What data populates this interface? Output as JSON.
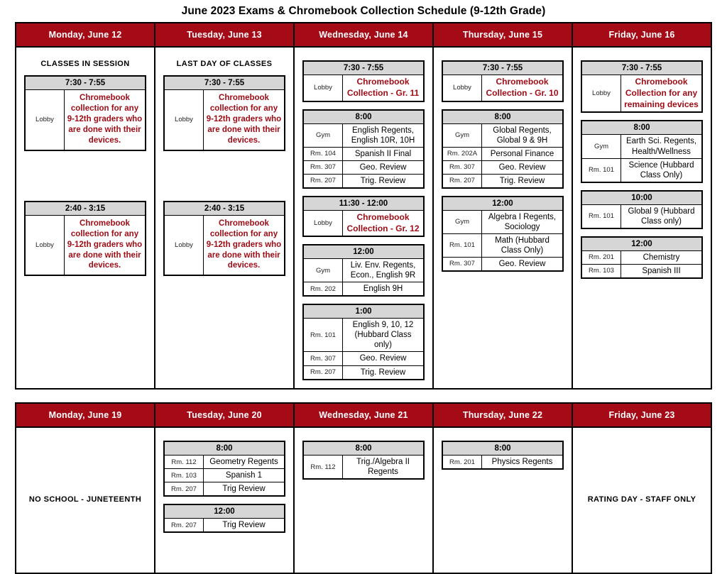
{
  "document": {
    "title": "June 2023 Exams & Chromebook Collection Schedule (9-12th Grade)",
    "accent_red": "#A50B16",
    "text_red": "#9E0B14",
    "timebar_gray": "#d6d6d6"
  },
  "weeks": [
    {
      "name": "week-1",
      "days": [
        {
          "header": "Monday, June 12",
          "note": "CLASSES IN SESSION",
          "note_center": false,
          "blocks": [
            {
              "time": "7:30 - 7:55",
              "rows": [
                {
                  "room": "Lobby",
                  "subject": "Chromebook collection for any 9-12th graders who are done with their devices.",
                  "style": "redpara"
                }
              ]
            },
            {
              "time": "2:40 - 3:15",
              "gap": "large",
              "rows": [
                {
                  "room": "Lobby",
                  "subject": "Chromebook collection for any 9-12th graders who are done with their devices.",
                  "style": "redpara"
                }
              ]
            }
          ]
        },
        {
          "header": "Tuesday, June 13",
          "note": "LAST DAY OF CLASSES",
          "note_center": false,
          "blocks": [
            {
              "time": "7:30 - 7:55",
              "rows": [
                {
                  "room": "Lobby",
                  "subject": "Chromebook collection for any 9-12th graders who are done with their devices.",
                  "style": "redpara"
                }
              ]
            },
            {
              "time": "2:40 - 3:15",
              "gap": "large",
              "rows": [
                {
                  "room": "Lobby",
                  "subject": "Chromebook collection for any 9-12th graders who are done with their devices.",
                  "style": "redpara"
                }
              ]
            }
          ]
        },
        {
          "header": "Wednesday, June 14",
          "note": "",
          "blocks": [
            {
              "time": "7:30 - 7:55",
              "rows": [
                {
                  "room": "Lobby",
                  "subject": "Chromebook Collection - Gr. 11",
                  "style": "red"
                }
              ]
            },
            {
              "time": "8:00",
              "rows": [
                {
                  "room": "Gym",
                  "subject": "English Regents, English 10R, 10H"
                },
                {
                  "room": "Rm. 104",
                  "subject": "Spanish II Final"
                },
                {
                  "room": "Rm. 307",
                  "subject": "Geo. Review"
                },
                {
                  "room": "Rm. 207",
                  "subject": "Trig. Review"
                }
              ]
            },
            {
              "time": "11:30 - 12:00",
              "rows": [
                {
                  "room": "Lobby",
                  "subject": "Chromebook Collection - Gr. 12",
                  "style": "red"
                }
              ]
            },
            {
              "time": "12:00",
              "rows": [
                {
                  "room": "Gym",
                  "subject": "Liv. Env. Regents, Econ., English 9R"
                },
                {
                  "room": "Rm. 202",
                  "subject": "English 9H"
                }
              ]
            },
            {
              "time": "1:00",
              "rows": [
                {
                  "room": "Rm. 101",
                  "subject": "English 9, 10, 12 (Hubbard Class only)"
                },
                {
                  "room": "Rm. 307",
                  "subject": "Geo. Review"
                },
                {
                  "room": "Rm. 207",
                  "subject": "Trig. Review"
                }
              ]
            }
          ]
        },
        {
          "header": "Thursday, June 15",
          "note": "",
          "blocks": [
            {
              "time": "7:30 - 7:55",
              "rows": [
                {
                  "room": "Lobby",
                  "subject": "Chromebook Collection - Gr. 10",
                  "style": "red"
                }
              ]
            },
            {
              "time": "8:00",
              "rows": [
                {
                  "room": "Gym",
                  "subject": "Global Regents, Global 9 & 9H"
                },
                {
                  "room": "Rm. 202A",
                  "subject": "Personal Finance"
                },
                {
                  "room": "Rm. 307",
                  "subject": "Geo. Review"
                },
                {
                  "room": "Rm. 207",
                  "subject": "Trig. Review"
                }
              ]
            },
            {
              "time": "12:00",
              "rows": [
                {
                  "room": "Gym",
                  "subject": "Algebra I Regents, Sociology"
                },
                {
                  "room": "Rm. 101",
                  "subject": "Math (Hubbard Class Only)"
                },
                {
                  "room": "Rm. 307",
                  "subject": "Geo. Review"
                }
              ]
            }
          ]
        },
        {
          "header": "Friday, June 16",
          "note": "",
          "blocks": [
            {
              "time": "7:30 - 7:55",
              "rows": [
                {
                  "room": "Lobby",
                  "subject": "Chromebook Collection for any remaining devices",
                  "style": "red"
                }
              ]
            },
            {
              "time": "8:00",
              "rows": [
                {
                  "room": "Gym",
                  "subject": "Earth Sci. Regents, Health/Wellness"
                },
                {
                  "room": "Rm. 101",
                  "subject": "Science (Hubbard Class Only)"
                }
              ]
            },
            {
              "time": "10:00",
              "rows": [
                {
                  "room": "Rm. 101",
                  "subject": "Global 9 (Hubbard Class only)"
                }
              ]
            },
            {
              "time": "12:00",
              "rows": [
                {
                  "room": "Rm. 201",
                  "subject": "Chemistry"
                },
                {
                  "room": "Rm. 103",
                  "subject": "Spanish III"
                }
              ]
            }
          ]
        }
      ]
    },
    {
      "name": "week-2",
      "days": [
        {
          "header": "Monday, June 19",
          "note": "NO SCHOOL - JUNETEENTH",
          "note_center": true,
          "blocks": []
        },
        {
          "header": "Tuesday, June 20",
          "note": "",
          "blocks": [
            {
              "time": "8:00",
              "rows": [
                {
                  "room": "Rm. 112",
                  "subject": "Geometry Regents"
                },
                {
                  "room": "Rm. 103",
                  "subject": "Spanish 1"
                },
                {
                  "room": "Rm. 207",
                  "subject": "Trig Review"
                }
              ]
            },
            {
              "time": "12:00",
              "rows": [
                {
                  "room": "Rm. 207",
                  "subject": "Trig Review"
                }
              ]
            }
          ]
        },
        {
          "header": "Wednesday, June 21",
          "note": "",
          "blocks": [
            {
              "time": "8:00",
              "rows": [
                {
                  "room": "Rm. 112",
                  "subject": "Trig./Algebra II Regents"
                }
              ]
            }
          ]
        },
        {
          "header": "Thursday, June 22",
          "note": "",
          "blocks": [
            {
              "time": "8:00",
              "rows": [
                {
                  "room": "Rm. 201",
                  "subject": "Physics Regents"
                }
              ]
            }
          ]
        },
        {
          "header": "Friday, June 23",
          "note": "RATING DAY - STAFF ONLY",
          "note_center": true,
          "blocks": []
        }
      ]
    }
  ]
}
